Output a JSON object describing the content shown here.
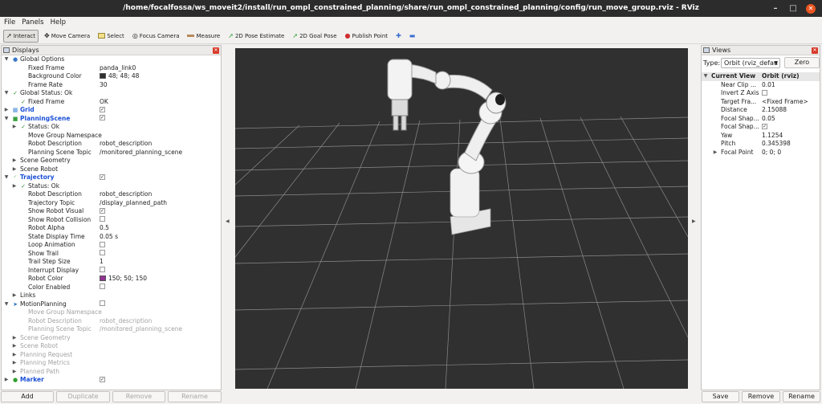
{
  "window": {
    "title": "/home/focalfossa/ws_moveit2/install/run_ompl_constrained_planning/share/run_ompl_constrained_planning/config/run_move_group.rviz - RViz"
  },
  "menu": [
    "File",
    "Panels",
    "Help"
  ],
  "toolbar": [
    {
      "label": "Interact",
      "icon": "cursor-icon"
    },
    {
      "label": "Move Camera",
      "icon": "move-camera-icon"
    },
    {
      "label": "Select",
      "icon": "select-icon"
    },
    {
      "label": "Focus Camera",
      "icon": "focus-camera-icon"
    },
    {
      "label": "Measure",
      "icon": "ruler-icon"
    },
    {
      "label": "2D Pose Estimate",
      "icon": "pose-estimate-icon"
    },
    {
      "label": "2D Goal Pose",
      "icon": "goal-pose-icon"
    },
    {
      "label": "Publish Point",
      "icon": "publish-point-icon"
    }
  ],
  "displays": {
    "title": "Displays",
    "rows": [
      {
        "label": "Global Options",
        "indent": 0,
        "arrow": "down",
        "icon": "globe-icon"
      },
      {
        "label": "Fixed Frame",
        "indent": 2,
        "value": "panda_link0"
      },
      {
        "label": "Background Color",
        "indent": 2,
        "value": "48; 48; 48",
        "swatch": "#303030"
      },
      {
        "label": "Frame Rate",
        "indent": 2,
        "value": "30"
      },
      {
        "label": "Global Status: Ok",
        "indent": 0,
        "arrow": "down",
        "check": true
      },
      {
        "label": "Fixed Frame",
        "indent": 1,
        "check": true,
        "value": "OK"
      },
      {
        "label": "Grid",
        "indent": 0,
        "arrow": "right",
        "icon": "grid-icon",
        "blue": true,
        "checkbox": true
      },
      {
        "label": "PlanningScene",
        "indent": 0,
        "arrow": "down",
        "icon": "scene-icon",
        "blue": true,
        "checkbox": true
      },
      {
        "label": "Status: Ok",
        "indent": 1,
        "arrow": "right",
        "check": true
      },
      {
        "label": "Move Group Namespace",
        "indent": 2
      },
      {
        "label": "Robot Description",
        "indent": 2,
        "value": "robot_description"
      },
      {
        "label": "Planning Scene Topic",
        "indent": 2,
        "value": "/monitored_planning_scene"
      },
      {
        "label": "Scene Geometry",
        "indent": 1,
        "arrow": "right"
      },
      {
        "label": "Scene Robot",
        "indent": 1,
        "arrow": "right"
      },
      {
        "label": "Trajectory",
        "indent": 0,
        "arrow": "down",
        "icon": "trajectory-icon",
        "blue": true,
        "checkbox": true
      },
      {
        "label": "Status: Ok",
        "indent": 1,
        "arrow": "right",
        "check": true
      },
      {
        "label": "Robot Description",
        "indent": 2,
        "value": "robot_description"
      },
      {
        "label": "Trajectory Topic",
        "indent": 2,
        "value": "/display_planned_path"
      },
      {
        "label": "Show Robot Visual",
        "indent": 2,
        "checkbox": true
      },
      {
        "label": "Show Robot Collision",
        "indent": 2,
        "checkbox": false
      },
      {
        "label": "Robot Alpha",
        "indent": 2,
        "value": "0.5"
      },
      {
        "label": "State Display Time",
        "indent": 2,
        "value": "0.05 s"
      },
      {
        "label": "Loop Animation",
        "indent": 2,
        "checkbox": false
      },
      {
        "label": "Show Trail",
        "indent": 2,
        "checkbox": false
      },
      {
        "label": "Trail Step Size",
        "indent": 2,
        "value": "1"
      },
      {
        "label": "Interrupt Display",
        "indent": 2,
        "checkbox": false
      },
      {
        "label": "Robot Color",
        "indent": 2,
        "value": "150; 50; 150",
        "swatch": "#963296"
      },
      {
        "label": "Color Enabled",
        "indent": 2,
        "checkbox": false
      },
      {
        "label": "Links",
        "indent": 1,
        "arrow": "right"
      },
      {
        "label": "MotionPlanning",
        "indent": 0,
        "arrow": "down",
        "icon": "motion-planning-icon",
        "checkbox": false
      },
      {
        "label": "Move Group Namespace",
        "indent": 2,
        "disabled": true
      },
      {
        "label": "Robot Description",
        "indent": 2,
        "value": "robot_description",
        "disabled": true
      },
      {
        "label": "Planning Scene Topic",
        "indent": 2,
        "value": "/monitored_planning_scene",
        "disabled": true
      },
      {
        "label": "Scene Geometry",
        "indent": 1,
        "arrow": "right",
        "disabled": true
      },
      {
        "label": "Scene Robot",
        "indent": 1,
        "arrow": "right",
        "disabled": true
      },
      {
        "label": "Planning Request",
        "indent": 1,
        "arrow": "right",
        "disabled": true
      },
      {
        "label": "Planning Metrics",
        "indent": 1,
        "arrow": "right",
        "disabled": true
      },
      {
        "label": "Planned Path",
        "indent": 1,
        "arrow": "right",
        "disabled": true
      },
      {
        "label": "Marker",
        "indent": 0,
        "arrow": "right",
        "icon": "marker-icon",
        "blue": true,
        "checkbox": true
      }
    ],
    "buttons": [
      {
        "label": "Add",
        "enabled": true
      },
      {
        "label": "Duplicate",
        "enabled": false
      },
      {
        "label": "Remove",
        "enabled": false
      },
      {
        "label": "Rename",
        "enabled": false
      }
    ]
  },
  "views": {
    "title": "Views",
    "type_label": "Type:",
    "type_value": "Orbit (rviz_defau",
    "zero_label": "Zero",
    "header": {
      "label": "Current View",
      "value": "Orbit (rviz)"
    },
    "rows": [
      {
        "label": "Near Clip ...",
        "value": "0.01"
      },
      {
        "label": "Invert Z Axis",
        "checkbox": false
      },
      {
        "label": "Target Fra...",
        "value": "<Fixed Frame>"
      },
      {
        "label": "Distance",
        "value": "2.15088"
      },
      {
        "label": "Focal Shap...",
        "value": "0.05"
      },
      {
        "label": "Focal Shap...",
        "checkbox": true
      },
      {
        "label": "Yaw",
        "value": "1.1254"
      },
      {
        "label": "Pitch",
        "value": "0.345398"
      },
      {
        "label": "Focal Point",
        "value": "0; 0; 0",
        "arrow": "right"
      }
    ],
    "buttons": [
      "Save",
      "Remove",
      "Rename"
    ]
  }
}
